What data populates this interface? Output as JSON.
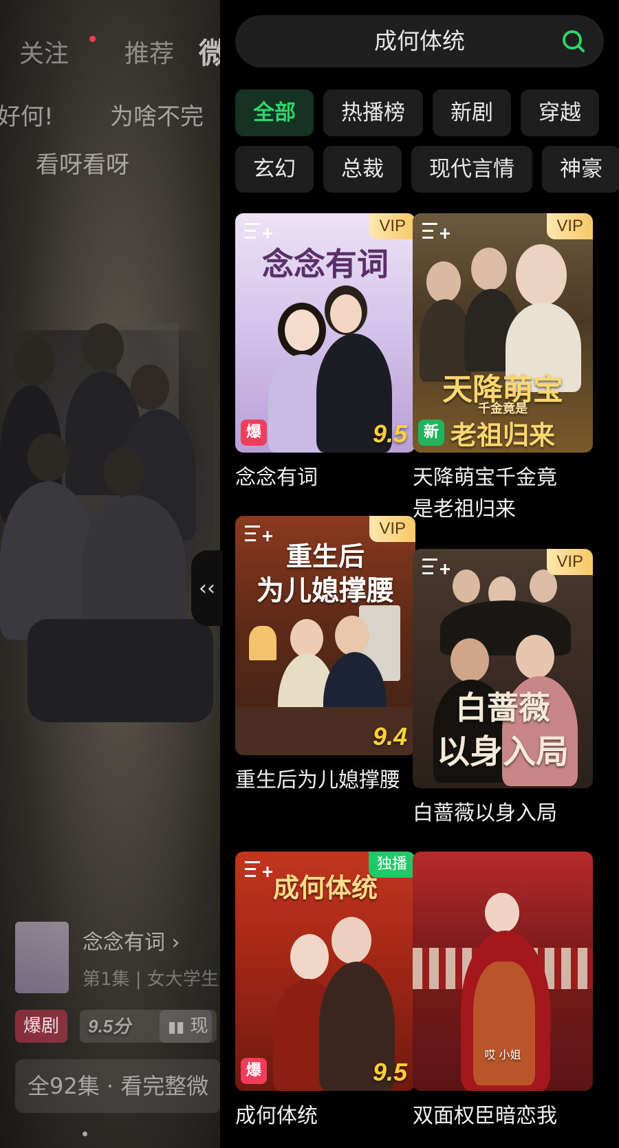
{
  "background": {
    "top_tabs": [
      "关注",
      "推荐",
      "微剧"
    ],
    "danmu": [
      "好何!",
      "为啥不完",
      "看呀看呀"
    ],
    "now_playing": {
      "title": "念念有词 ›",
      "subtitle": "第1集 | 女大学生",
      "hot_tag": "爆剧",
      "score_tag": "9.5分",
      "rank_tag": "现",
      "bottom_bar": "全92集 · 看完整微"
    },
    "collapse_label": "‹‹"
  },
  "search": {
    "query": "成何体统",
    "icon": "search-icon",
    "accent": "#2fd46a"
  },
  "categories": {
    "row1": [
      "全部",
      "热播榜",
      "新剧",
      "穿越"
    ],
    "row2": [
      "玄幻",
      "总裁",
      "现代言情",
      "神豪"
    ]
  },
  "cards": [
    {
      "title": "念念有词",
      "poster_text": "念念有词",
      "badge_top": "VIP",
      "badge_bottom": "爆",
      "score": "9.5"
    },
    {
      "title": "天降萌宝千金竟是老祖归来",
      "poster_text": "天降萌宝",
      "poster_sub": "千金竟是",
      "poster_text2": "老祖归来",
      "badge_top": "VIP",
      "badge_bottom": "新",
      "score": ""
    },
    {
      "title": "重生后为儿媳撑腰",
      "poster_text": "重生后",
      "poster_text2": "为儿媳撑腰",
      "badge_top": "VIP",
      "badge_bottom": "",
      "score": "9.4"
    },
    {
      "title": "白蔷薇以身入局",
      "poster_text": "白蔷薇",
      "poster_text2": "以身入局",
      "badge_top": "VIP",
      "badge_bottom": "",
      "score": ""
    },
    {
      "title": "成何体统",
      "poster_text": "成何体统",
      "badge_top": "独播",
      "badge_bottom": "爆",
      "score": "9.5"
    },
    {
      "title": "双面权臣暗恋我",
      "poster_text": "哎 小姐",
      "badge_top": "",
      "badge_bottom": "",
      "score": ""
    }
  ]
}
